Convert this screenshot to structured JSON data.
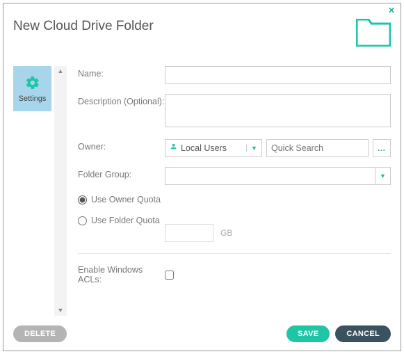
{
  "dialog": {
    "title": "New Cloud Drive Folder"
  },
  "sidebar": {
    "items": [
      {
        "label": "Settings"
      }
    ]
  },
  "form": {
    "name_label": "Name:",
    "name_value": "",
    "desc_label": "Description (Optional):",
    "desc_value": "",
    "owner_label": "Owner:",
    "owner_scope": "Local Users",
    "quick_search_placeholder": "Quick Search",
    "folder_group_label": "Folder Group:",
    "folder_group_value": "",
    "quota": {
      "use_owner_label": "Use Owner Quota",
      "use_folder_label": "Use Folder Quota",
      "selected": "owner",
      "folder_quota_value": "",
      "unit": "GB"
    },
    "acl_label": "Enable Windows ACLs:",
    "acl_checked": false
  },
  "footer": {
    "delete_label": "DELETE",
    "save_label": "SAVE",
    "cancel_label": "CANCEL"
  }
}
